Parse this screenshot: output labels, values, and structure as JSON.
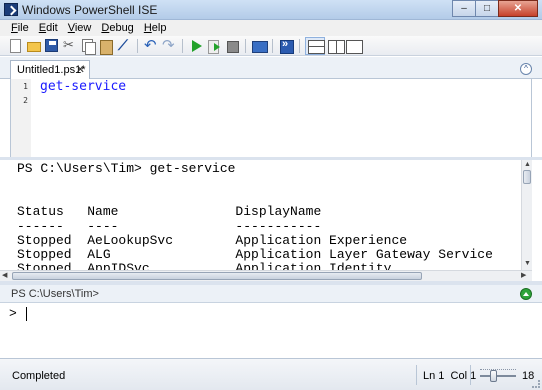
{
  "window": {
    "title": "Windows PowerShell ISE",
    "minimize": "–",
    "maximize": "□",
    "close": "✕"
  },
  "menu": [
    {
      "u": "F",
      "rest": "ile"
    },
    {
      "u": "E",
      "rest": "dit"
    },
    {
      "u": "V",
      "rest": "iew"
    },
    {
      "u": "D",
      "rest": "ebug"
    },
    {
      "u": "H",
      "rest": "elp"
    }
  ],
  "toolbar": {
    "icons": [
      "new-icon",
      "open-icon",
      "save-icon",
      "cut-icon",
      "copy-icon",
      "paste-icon",
      "clear-icon",
      "undo-icon",
      "redo-icon",
      "run-icon",
      "run-selection-icon",
      "stop-icon",
      "remote-tab-icon",
      "powershell-icon",
      "layout-top-icon",
      "layout-right-icon",
      "layout-max-icon"
    ]
  },
  "tabs": {
    "active_label": "Untitled1.ps1*",
    "close_glyph": "✕",
    "collapse_glyph": "^"
  },
  "script": {
    "line_numbers": [
      "1",
      "2"
    ],
    "lines": [
      "get-service"
    ]
  },
  "output": {
    "lines": [
      "PS C:\\Users\\Tim> get-service",
      "",
      "",
      "Status   Name               DisplayName",
      "------   ----               -----------",
      "Stopped  AeLookupSvc        Application Experience",
      "Stopped  ALG                Application Layer Gateway Service",
      "Stopped  AppIDSvc           Application Identity"
    ]
  },
  "command": {
    "prompt": "PS C:\\Users\\Tim>",
    "input_prefix": ">",
    "value": ""
  },
  "status": {
    "text": "Completed",
    "line": "Ln 1",
    "col": "Col 1",
    "zoom": "18"
  }
}
